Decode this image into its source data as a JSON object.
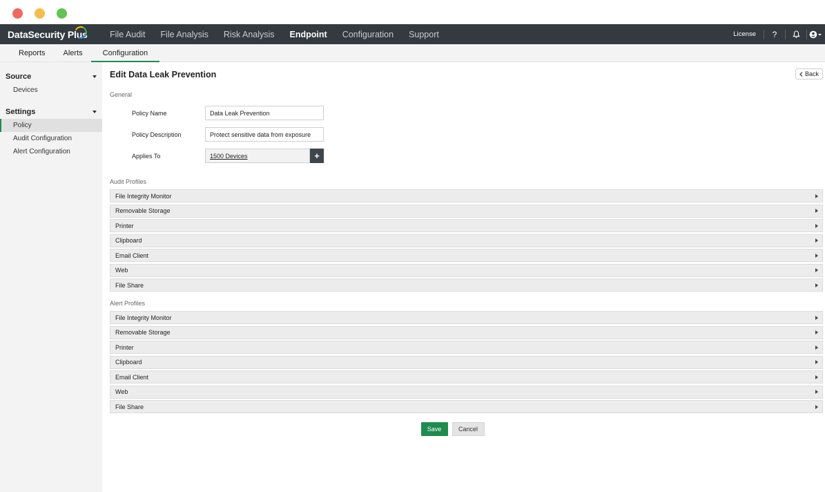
{
  "app": {
    "brand": "DataSecurity Plus"
  },
  "topnav": {
    "items": [
      "File Audit",
      "File Analysis",
      "Risk Analysis",
      "Endpoint",
      "Configuration",
      "Support"
    ],
    "active": "Endpoint",
    "license": "License",
    "help": "?"
  },
  "subtabs": {
    "items": [
      "Reports",
      "Alerts",
      "Configuration"
    ],
    "active": "Configuration"
  },
  "sidebar": {
    "source": {
      "label": "Source",
      "items": [
        "Devices"
      ]
    },
    "settings": {
      "label": "Settings",
      "items": [
        "Policy",
        "Audit Configuration",
        "Alert Configuration"
      ]
    },
    "active": "Policy"
  },
  "page": {
    "title": "Edit Data Leak Prevention",
    "back": "Back"
  },
  "general": {
    "label": "General",
    "policy_name_label": "Policy Name",
    "policy_name_value": "Data Leak Prevention",
    "policy_desc_label": "Policy Description",
    "policy_desc_value": "Protect sensitive data from exposure",
    "applies_label": "Applies To",
    "applies_value": "1500 Devices",
    "add": "+"
  },
  "audit_profiles": {
    "label": "Audit Profiles",
    "items": [
      "File Integrity Monitor",
      "Removable Storage",
      "Printer",
      "Clipboard",
      "Email Client",
      "Web",
      "File Share"
    ]
  },
  "alert_profiles": {
    "label": "Alert Profiles",
    "items": [
      "File Integrity Monitor",
      "Removable Storage",
      "Printer",
      "Clipboard",
      "Email Client",
      "Web",
      "File Share"
    ]
  },
  "actions": {
    "save": "Save",
    "cancel": "Cancel"
  },
  "colors": {
    "accent": "#1e8c4e",
    "nav_bg": "#333a40"
  }
}
